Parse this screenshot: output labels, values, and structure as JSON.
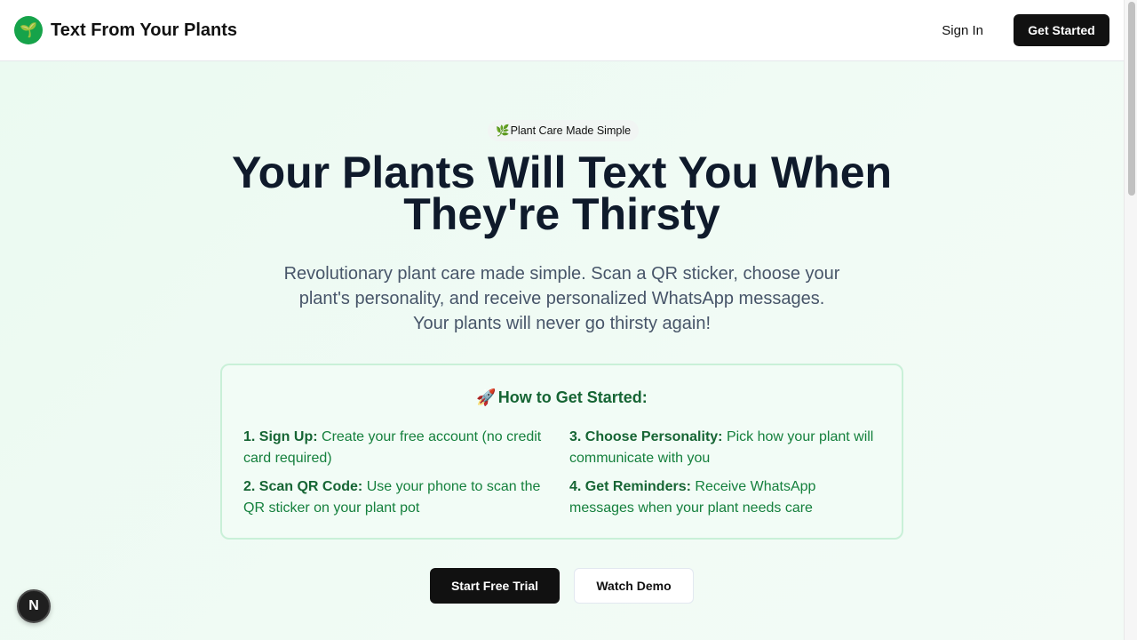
{
  "header": {
    "logo_icon": "🌱",
    "brand": "Text From Your Plants",
    "sign_in": "Sign In",
    "get_started": "Get Started"
  },
  "hero": {
    "badge_icon": "🌿",
    "badge_text": "Plant Care Made Simple",
    "title_line1": "Your Plants Will Text You When",
    "title_line2": "They're Thirsty",
    "subtitle_line1": "Revolutionary plant care made simple. Scan a QR sticker, choose your",
    "subtitle_line2": "plant's personality, and receive personalized WhatsApp messages.",
    "subtitle_line3": "Your plants will never go thirsty again!"
  },
  "how_to": {
    "icon": "🚀",
    "title": "How to Get Started:",
    "steps": [
      {
        "label": "1. Sign Up:",
        "text": "Create your free account (no credit card required)"
      },
      {
        "label": "2. Scan QR Code:",
        "text": "Use your phone to scan the QR sticker on your plant pot"
      },
      {
        "label": "3. Choose Personality:",
        "text": "Pick how your plant will communicate with you"
      },
      {
        "label": "4. Get Reminders:",
        "text": "Receive WhatsApp messages when your plant needs care"
      }
    ]
  },
  "cta": {
    "primary": "Start Free Trial",
    "secondary": "Watch Demo"
  },
  "dev_badge": "N",
  "colors": {
    "accent_green": "#16a34a",
    "dark_green": "#166534",
    "button_dark": "#111111",
    "background": "#f1fbf5"
  }
}
